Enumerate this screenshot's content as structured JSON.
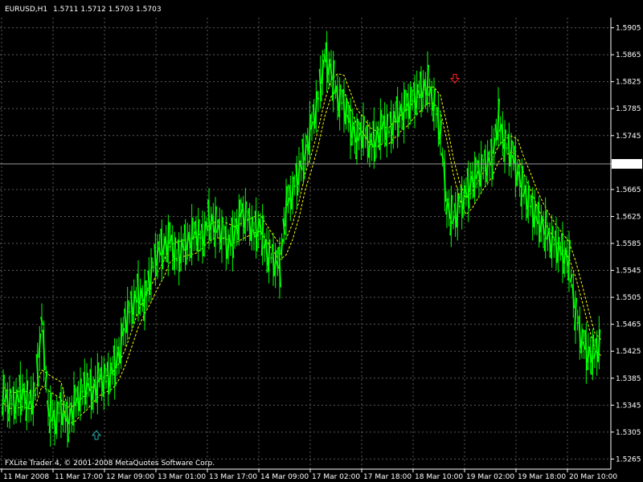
{
  "header": {
    "symbol_tf": "EURUSD,H1",
    "ohlc": "1.5711 1.5712 1.5703 1.5703"
  },
  "footer": {
    "copyright": "FXLite Trader 4, © 2001-2008 MetaQuotes Software Corp."
  },
  "colors": {
    "background": "#000000",
    "grid": "#5a5a5a",
    "candle": "#00ff00",
    "envelope": "#ffff00",
    "text": "#ffffff",
    "price_line": "#9a9a9a",
    "buy_arrow": "#20b2aa",
    "sell_arrow": "#ff2020"
  },
  "chart_data": {
    "type": "line",
    "title": "EURUSD,H1",
    "xlabel": "",
    "ylabel": "",
    "ylim": [
      1.525,
      1.592
    ],
    "y_ticks": [
      "1.5905",
      "1.5865",
      "1.5825",
      "1.5785",
      "1.5745",
      "1.5703",
      "1.5665",
      "1.5625",
      "1.5585",
      "1.5545",
      "1.5505",
      "1.5465",
      "1.5425",
      "1.5385",
      "1.5345",
      "1.5305",
      "1.5265"
    ],
    "x_ticks": [
      "11 Mar 2008",
      "11 Mar 17:00",
      "12 Mar 09:00",
      "13 Mar 01:00",
      "13 Mar 17:00",
      "14 Mar 09:00",
      "17 Mar 02:00",
      "17 Mar 18:00",
      "18 Mar 10:00",
      "19 Mar 02:00",
      "19 Mar 18:00",
      "20 Mar 10:00"
    ],
    "current_price": "1.5703",
    "grid": true,
    "series": [
      {
        "name": "",
        "x": [
          0,
          8,
          16,
          24,
          32,
          40,
          48,
          56,
          64,
          72,
          80,
          88,
          96,
          104,
          112,
          120,
          128,
          136,
          144,
          152,
          160,
          168,
          176,
          184,
          192,
          200,
          208,
          216,
          224,
          232,
          240,
          248,
          256,
          264,
          272,
          280,
          288,
          296,
          304,
          312,
          320,
          328,
          336,
          344,
          352,
          360,
          368,
          376,
          384,
          392,
          400,
          408,
          416,
          424,
          432,
          440,
          448,
          456,
          464,
          472,
          480,
          488,
          496,
          504,
          512,
          520,
          528,
          536,
          544,
          552,
          560,
          568,
          576,
          584,
          592,
          600,
          608,
          616,
          624,
          632,
          640,
          648,
          656,
          664,
          672,
          680,
          688,
          696,
          704,
          712,
          720,
          728,
          736,
          744
        ],
        "values": [
          1.536,
          1.5345,
          1.535,
          1.5365,
          1.5345,
          1.536,
          1.547,
          1.534,
          1.532,
          1.534,
          1.532,
          1.5345,
          1.536,
          1.5375,
          1.5365,
          1.5385,
          1.538,
          1.5395,
          1.542,
          1.547,
          1.549,
          1.551,
          1.55,
          1.554,
          1.557,
          1.558,
          1.559,
          1.556,
          1.558,
          1.559,
          1.56,
          1.559,
          1.562,
          1.561,
          1.56,
          1.558,
          1.56,
          1.563,
          1.562,
          1.56,
          1.561,
          1.557,
          1.556,
          1.555,
          1.564,
          1.566,
          1.569,
          1.572,
          1.576,
          1.58,
          1.586,
          1.584,
          1.58,
          1.579,
          1.576,
          1.574,
          1.575,
          1.573,
          1.574,
          1.576,
          1.575,
          1.577,
          1.578,
          1.579,
          1.58,
          1.581,
          1.582,
          1.579,
          1.575,
          1.564,
          1.562,
          1.564,
          1.566,
          1.568,
          1.569,
          1.57,
          1.571,
          1.577,
          1.573,
          1.572,
          1.569,
          1.566,
          1.564,
          1.562,
          1.561,
          1.559,
          1.558,
          1.557,
          1.556,
          1.548,
          1.544,
          1.542,
          1.542,
          1.544
        ]
      }
    ],
    "markers": [
      {
        "type": "buy",
        "x": 120,
        "y": 1.53
      },
      {
        "type": "sell",
        "x": 566,
        "y": 1.583
      }
    ]
  }
}
